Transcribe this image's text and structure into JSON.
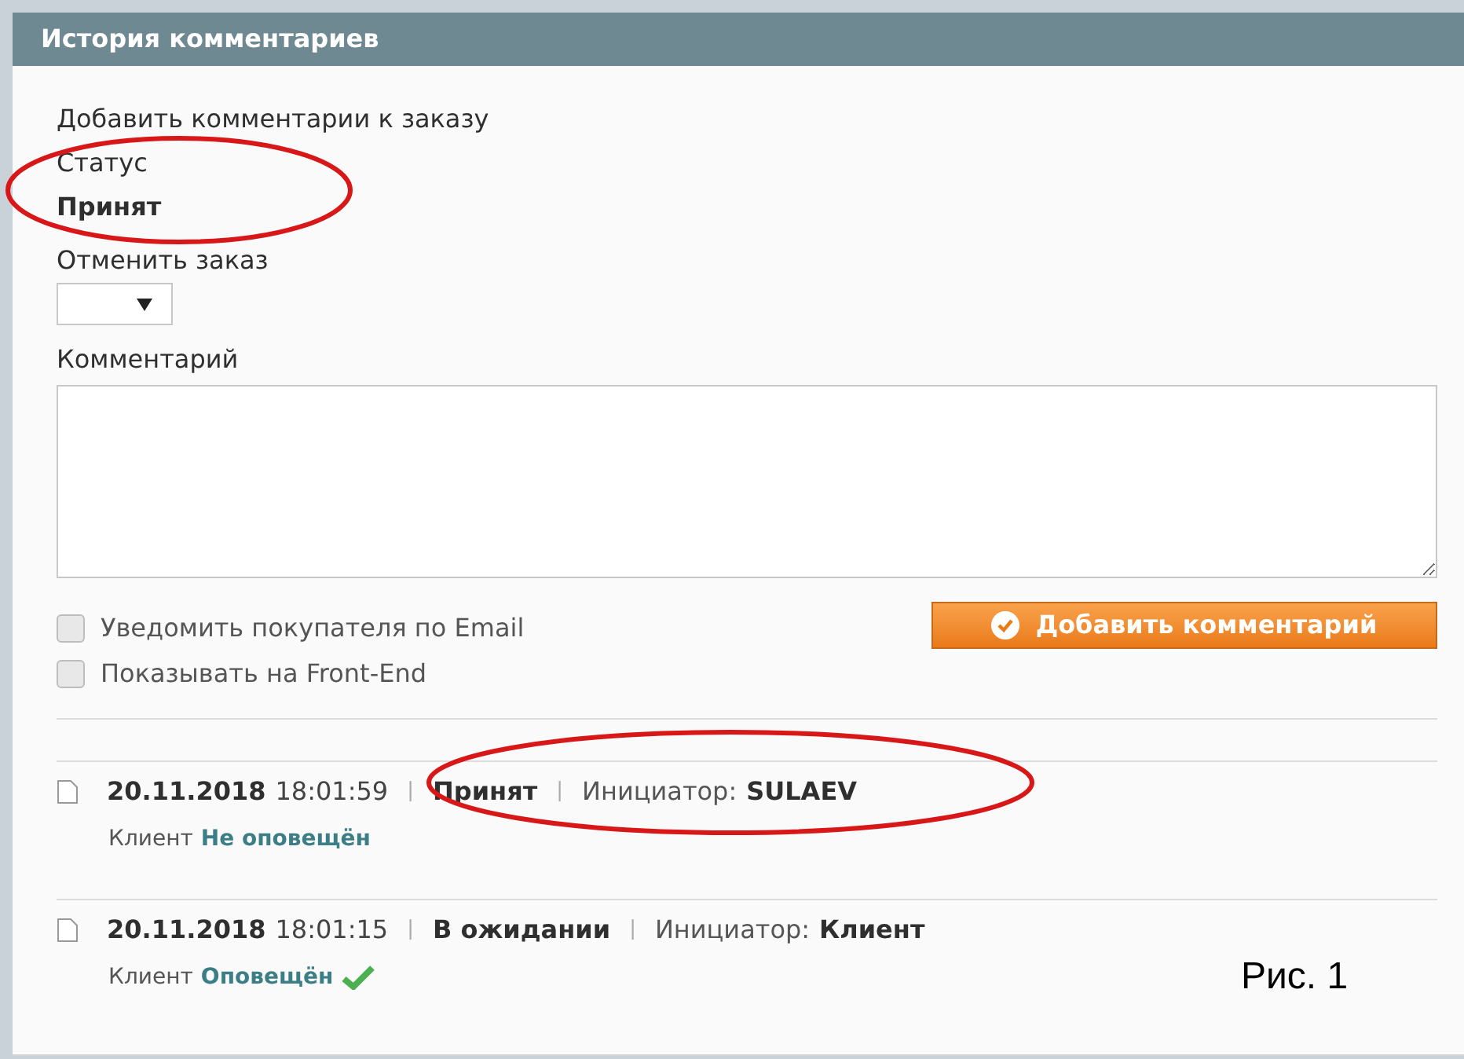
{
  "panel": {
    "title": "История комментариев"
  },
  "form": {
    "heading": "Добавить комментарии к заказу",
    "status_label": "Статус",
    "status_value": "Принят",
    "cancel_label": "Отменить заказ",
    "comment_label": "Комментарий",
    "options": [
      {
        "label": "Уведомить покупателя по Email",
        "checked": false
      },
      {
        "label": "Показывать на Front-End",
        "checked": false
      }
    ],
    "submit": "Добавить комментарий"
  },
  "history": [
    {
      "date": "20.11.2018",
      "time": "18:01:59",
      "separator": "|",
      "status": "Принят",
      "initiator_label": "Инициатор:",
      "initiator": "SULAEV",
      "customer_label": "Клиент",
      "notice": "Не оповещён",
      "notified": false
    },
    {
      "date": "20.11.2018",
      "time": "18:01:15",
      "separator": "|",
      "status": "В ожидании",
      "initiator_label": "Инициатор:",
      "initiator": "Клиент",
      "customer_label": "Клиент",
      "notice": "Оповещён",
      "notified": true
    }
  ],
  "caption": "Рис. 1"
}
